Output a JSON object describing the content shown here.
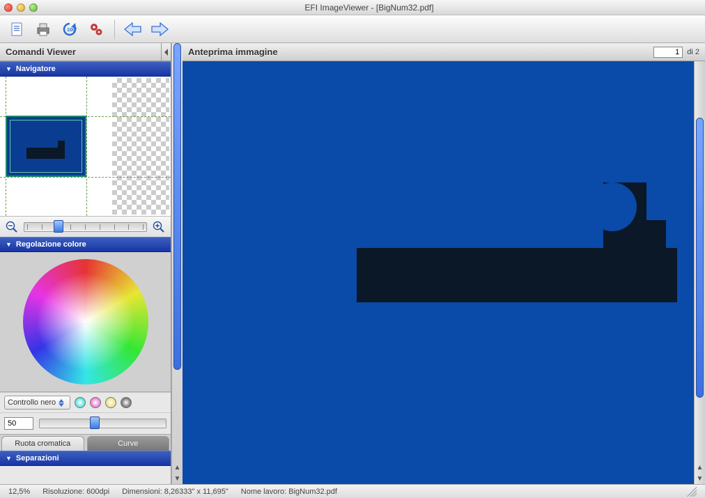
{
  "window": {
    "title": "EFI ImageViewer - [BigNum32.pdf]"
  },
  "sidebar": {
    "title": "Comandi Viewer",
    "nav_header": "Navigatore",
    "color_header": "Regolazione colore",
    "sep_header": "Separazioni",
    "control_select": "Controllo nero",
    "value_input": "50",
    "tab_wheel": "Ruota cromatica",
    "tab_curve": "Curve"
  },
  "preview": {
    "title": "Anteprima immagine",
    "page_input": "1",
    "page_of": "di 2"
  },
  "status": {
    "zoom": "12,5%",
    "res": "Risoluzione: 600dpi",
    "dim": "Dimensioni: 8,26333\" x 11,695\"",
    "job": "Nome lavoro: BigNum32.pdf"
  }
}
